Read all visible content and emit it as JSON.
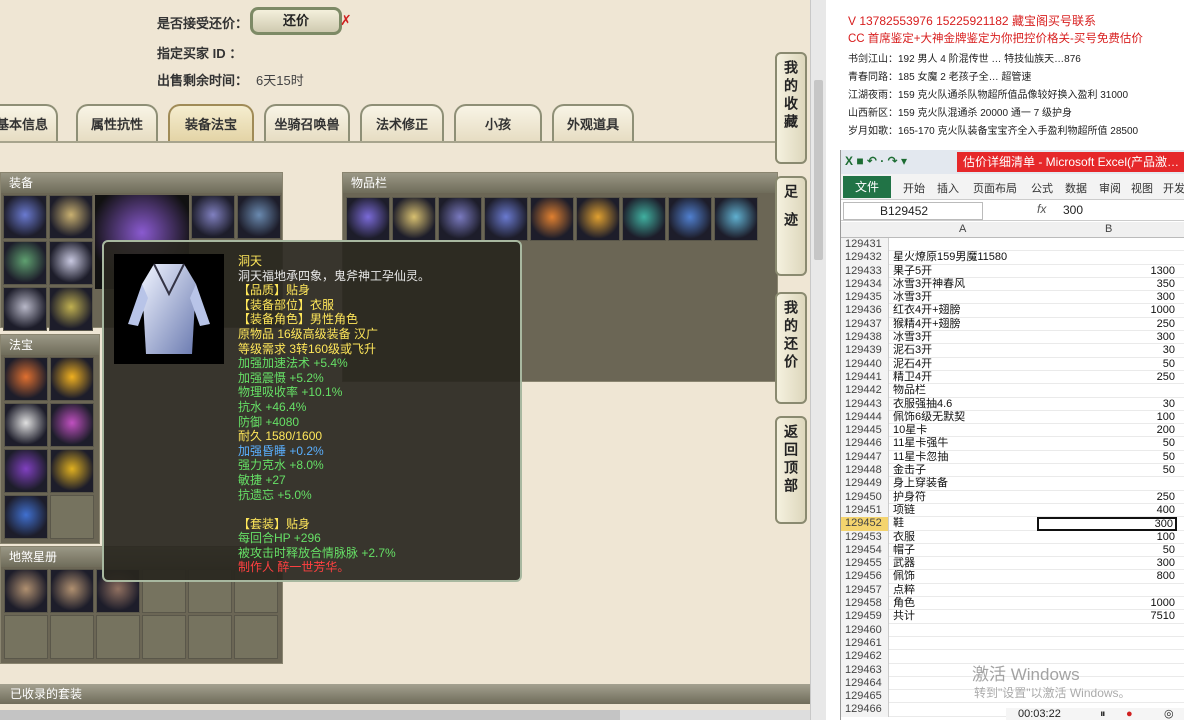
{
  "trade": {
    "accept_label": "是否接受还价：",
    "accept_button": "还价",
    "buyer_label": "指定买家 ID ：",
    "time_label": "出售剩余时间：",
    "time_value": "6天15时"
  },
  "tabs": [
    "基本信息",
    "属性抗性",
    "装备法宝",
    "坐骑召唤兽",
    "法术修正",
    "小孩",
    "外观道具"
  ],
  "active_tab": 2,
  "panels": {
    "equip": "装备",
    "inventory": "物品栏",
    "fabao": "法宝",
    "stars": "地煞星册",
    "collected": "已收录的套装"
  },
  "side_buttons": [
    "我的收藏",
    "足迹",
    "我的还价",
    "返回顶部"
  ],
  "tooltip": {
    "name": "洞天",
    "desc": "洞天福地承四象，鬼斧神工孕仙灵。",
    "lines": [
      {
        "t": "【品质】贴身",
        "c": "y"
      },
      {
        "t": "【装备部位】衣服",
        "c": "y"
      },
      {
        "t": "【装备角色】男性角色",
        "c": "y"
      },
      {
        "t": "原物品 16级高级装备 汉广",
        "c": "y"
      },
      {
        "t": "等级需求 3转160级或飞升",
        "c": "y"
      },
      {
        "t": "加强加速法术 +5.4%",
        "c": "g"
      },
      {
        "t": "加强震慑 +5.2%",
        "c": "g"
      },
      {
        "t": "物理吸收率 +10.1%",
        "c": "g"
      },
      {
        "t": "抗水 +46.4%",
        "c": "g"
      },
      {
        "t": "防御 +4080",
        "c": "g"
      },
      {
        "t": "耐久 1580/1600",
        "c": "y"
      },
      {
        "t": "加强昏睡 +0.2%",
        "c": "b"
      },
      {
        "t": "强力克水 +8.0%",
        "c": "g"
      },
      {
        "t": "敏捷 +27",
        "c": "g"
      },
      {
        "t": "抗遗忘 +5.0%",
        "c": "g"
      },
      {
        "t": "",
        "c": "w"
      },
      {
        "t": "【套装】贴身",
        "c": "y"
      },
      {
        "t": "每回合HP +296",
        "c": "g"
      },
      {
        "t": "被攻击时释放合情脉脉 +2.7%",
        "c": "g"
      },
      {
        "t": "制作人 醉一世芳华。",
        "c": "r"
      }
    ]
  },
  "right_top": {
    "red": [
      "V 13782553976    15225921182   藏宝阁买号联系",
      "CC 首席鉴定+大神金牌鉴定为你把控价格关-买号免费估价"
    ],
    "dark": [
      "书剑江山：192 男人 4 阶混传世 … 特技仙族天…876",
      "青春同路：185 女魔 2 老孩子全… 超管速",
      "江湖夜雨：159 克火队通杀队物超所值品像较好换入盈利 31000",
      "山西新区：159 克火队混通杀 20000 通一 7 级护身",
      "岁月如歌：165-170 克火队装备宝宝齐全入手盈利物超所值 28500"
    ]
  },
  "excel": {
    "title": "估价详细清单 - Microsoft Excel(产品激…",
    "file_tab": "文件",
    "ribbon_tabs": [
      "开始",
      "插入",
      "页面布局",
      "公式",
      "数据",
      "审阅",
      "视图",
      "开发"
    ],
    "name_box": "B129452",
    "formula_value": "300",
    "col_a": "A",
    "col_b": "B",
    "rows": [
      [
        "129431",
        "",
        ""
      ],
      [
        "129432",
        "星火燎原159男魔11580",
        ""
      ],
      [
        "129433",
        "果子5开",
        "1300"
      ],
      [
        "129434",
        "冰雪3开神春风",
        "350"
      ],
      [
        "129435",
        "冰雪3开",
        "300"
      ],
      [
        "129436",
        "红衣4开+翅膀",
        "1000"
      ],
      [
        "129437",
        "猴精4开+翅膀",
        "250"
      ],
      [
        "129438",
        "冰雪3开",
        "300"
      ],
      [
        "129439",
        "泥石3开",
        "30"
      ],
      [
        "129440",
        "泥石4开",
        "50"
      ],
      [
        "129441",
        "精卫4开",
        "250"
      ],
      [
        "129442",
        "物品栏",
        ""
      ],
      [
        "129443",
        "衣服强抽4.6",
        "30"
      ],
      [
        "129444",
        "佩饰6级无默契",
        "100"
      ],
      [
        "129445",
        "10星卡",
        "200"
      ],
      [
        "129446",
        "11星卡强牛",
        "50"
      ],
      [
        "129447",
        "11星卡忽抽",
        "50"
      ],
      [
        "129448",
        "金击子",
        "50"
      ],
      [
        "129449",
        "身上穿装备",
        ""
      ],
      [
        "129450",
        "护身符",
        "250"
      ],
      [
        "129451",
        "项链",
        "400"
      ],
      [
        "129452",
        "鞋",
        "300"
      ],
      [
        "129453",
        "衣服",
        "100"
      ],
      [
        "129454",
        "帽子",
        "50"
      ],
      [
        "129455",
        "武器",
        "300"
      ],
      [
        "129456",
        "佩饰",
        "800"
      ],
      [
        "129457",
        "点粹",
        ""
      ],
      [
        "129458",
        "角色",
        "1000"
      ],
      [
        "129459",
        "共计",
        "7510"
      ],
      [
        "129460",
        "",
        ""
      ],
      [
        "129461",
        "",
        ""
      ],
      [
        "129462",
        "",
        ""
      ],
      [
        "129463",
        "",
        ""
      ],
      [
        "129464",
        "",
        ""
      ],
      [
        "129465",
        "",
        ""
      ],
      [
        "129466",
        "",
        ""
      ]
    ],
    "selected_row": 21
  },
  "windows": {
    "line1": "激活 Windows",
    "line2": "转到\"设置\"以激活 Windows。"
  },
  "recorder": {
    "time": "00:03:22"
  }
}
